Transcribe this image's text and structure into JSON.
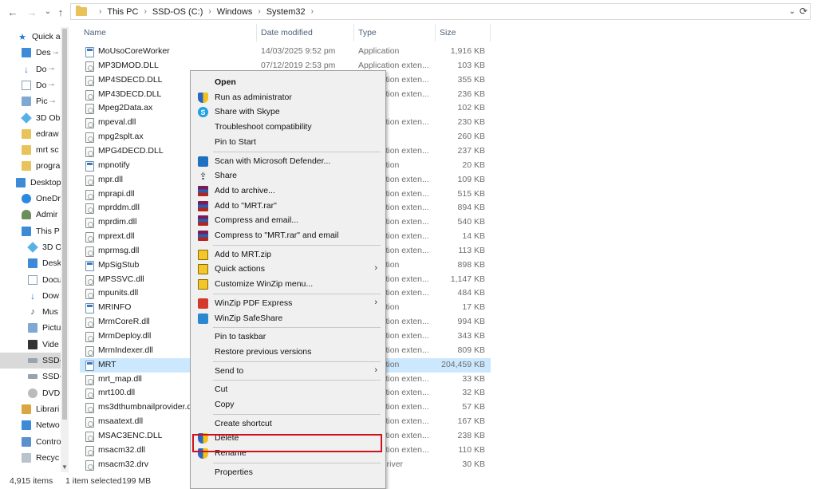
{
  "nav": {
    "back": "←",
    "forward": "→",
    "recent": "⌄",
    "up": "↑",
    "path": [
      "This PC",
      "SSD-OS (C:)",
      "Windows",
      "System32"
    ],
    "sep": "›",
    "dropdown": "⌄",
    "refresh": "⟳"
  },
  "navpane": [
    {
      "label": "Quick a",
      "icon": "star-icon",
      "pin": ""
    },
    {
      "label": "Des",
      "icon": "desktop-icon",
      "pin": "📌"
    },
    {
      "label": "Do",
      "icon": "download-icon",
      "pin": "📌"
    },
    {
      "label": "Do",
      "icon": "documents-icon",
      "pin": "📌"
    },
    {
      "label": "Pic",
      "icon": "pictures-icon",
      "pin": "📌"
    },
    {
      "label": "3D Ob",
      "icon": "3d-objects-icon",
      "pin": ""
    },
    {
      "label": "edraw",
      "icon": "folder-icon",
      "pin": ""
    },
    {
      "label": "mrt sc",
      "icon": "folder-icon",
      "pin": ""
    },
    {
      "label": "progra",
      "icon": "folder-icon",
      "pin": ""
    },
    {
      "label": "Desktop",
      "icon": "desktop-icon",
      "pin": ""
    },
    {
      "label": "OneDr",
      "icon": "onedrive-icon",
      "pin": ""
    },
    {
      "label": "Admir",
      "icon": "user-icon",
      "pin": ""
    },
    {
      "label": "This P",
      "icon": "computer-icon",
      "pin": ""
    },
    {
      "label": "3D O",
      "icon": "3d-objects-icon",
      "pin": ""
    },
    {
      "label": "Desk",
      "icon": "desktop-icon",
      "pin": ""
    },
    {
      "label": "Docu",
      "icon": "documents-icon",
      "pin": ""
    },
    {
      "label": "Dow",
      "icon": "download-icon",
      "pin": ""
    },
    {
      "label": "Mus",
      "icon": "music-icon",
      "pin": ""
    },
    {
      "label": "Pictu",
      "icon": "pictures-icon",
      "pin": ""
    },
    {
      "label": "Vide",
      "icon": "videos-icon",
      "pin": ""
    },
    {
      "label": "SSD-",
      "icon": "drive-icon",
      "pin": ""
    },
    {
      "label": "SSD-",
      "icon": "drive-icon",
      "pin": ""
    },
    {
      "label": "DVD",
      "icon": "dvd-icon",
      "pin": ""
    },
    {
      "label": "Librari",
      "icon": "library-icon",
      "pin": ""
    },
    {
      "label": "Netwo",
      "icon": "network-icon",
      "pin": ""
    },
    {
      "label": "Contro",
      "icon": "control-panel-icon",
      "pin": ""
    },
    {
      "label": "Recyc",
      "icon": "recycle-bin-icon",
      "pin": ""
    }
  ],
  "columns": {
    "name": "Name",
    "date": "Date modified",
    "type": "Type",
    "size": "Size"
  },
  "files": [
    {
      "name": "MoUsoCoreWorker",
      "date": "14/03/2025 9:52 pm",
      "type": "Application",
      "size": "1,916 KB",
      "kind": "app"
    },
    {
      "name": "MP3DMOD.DLL",
      "date": "07/12/2019 2:53 pm",
      "type": "Application exten...",
      "size": "103 KB",
      "kind": "dll"
    },
    {
      "name": "MP4SDECD.DLL",
      "date": "",
      "type": "Application exten...",
      "size": "355 KB",
      "kind": "dll"
    },
    {
      "name": "MP43DECD.DLL",
      "date": "",
      "type": "Application exten...",
      "size": "236 KB",
      "kind": "dll"
    },
    {
      "name": "Mpeg2Data.ax",
      "date": "",
      "type": "",
      "size": "102 KB",
      "kind": "dll"
    },
    {
      "name": "mpeval.dll",
      "date": "",
      "type": "Application exten...",
      "size": "230 KB",
      "kind": "dll"
    },
    {
      "name": "mpg2splt.ax",
      "date": "",
      "type": "",
      "size": "260 KB",
      "kind": "dll"
    },
    {
      "name": "MPG4DECD.DLL",
      "date": "",
      "type": "Application exten...",
      "size": "237 KB",
      "kind": "dll"
    },
    {
      "name": "mpnotify",
      "date": "",
      "type": "Application",
      "size": "20 KB",
      "kind": "app"
    },
    {
      "name": "mpr.dll",
      "date": "",
      "type": "Application exten...",
      "size": "109 KB",
      "kind": "dll"
    },
    {
      "name": "mprapi.dll",
      "date": "",
      "type": "Application exten...",
      "size": "515 KB",
      "kind": "dll"
    },
    {
      "name": "mprddm.dll",
      "date": "",
      "type": "Application exten...",
      "size": "894 KB",
      "kind": "dll"
    },
    {
      "name": "mprdim.dll",
      "date": "",
      "type": "Application exten...",
      "size": "540 KB",
      "kind": "dll"
    },
    {
      "name": "mprext.dll",
      "date": "",
      "type": "Application exten...",
      "size": "14 KB",
      "kind": "dll"
    },
    {
      "name": "mprmsg.dll",
      "date": "",
      "type": "Application exten...",
      "size": "113 KB",
      "kind": "dll"
    },
    {
      "name": "MpSigStub",
      "date": "",
      "type": "Application",
      "size": "898 KB",
      "kind": "app"
    },
    {
      "name": "MPSSVC.dll",
      "date": "",
      "type": "Application exten...",
      "size": "1,147 KB",
      "kind": "dll"
    },
    {
      "name": "mpunits.dll",
      "date": "",
      "type": "Application exten...",
      "size": "484 KB",
      "kind": "dll"
    },
    {
      "name": "MRINFO",
      "date": "",
      "type": "Application",
      "size": "17 KB",
      "kind": "app"
    },
    {
      "name": "MrmCoreR.dll",
      "date": "",
      "type": "Application exten...",
      "size": "994 KB",
      "kind": "dll"
    },
    {
      "name": "MrmDeploy.dll",
      "date": "",
      "type": "Application exten...",
      "size": "343 KB",
      "kind": "dll"
    },
    {
      "name": "MrmIndexer.dll",
      "date": "",
      "type": "Application exten...",
      "size": "809 KB",
      "kind": "dll"
    },
    {
      "name": "MRT",
      "date": "",
      "type": "Application",
      "size": "204,459 KB",
      "kind": "app",
      "selected": true
    },
    {
      "name": "mrt_map.dll",
      "date": "",
      "type": "Application exten...",
      "size": "33 KB",
      "kind": "dll"
    },
    {
      "name": "mrt100.dll",
      "date": "",
      "type": "Application exten...",
      "size": "32 KB",
      "kind": "dll"
    },
    {
      "name": "ms3dthumbnailprovider.dll",
      "date": "",
      "type": "Application exten...",
      "size": "57 KB",
      "kind": "dll"
    },
    {
      "name": "msaatext.dll",
      "date": "",
      "type": "Application exten...",
      "size": "167 KB",
      "kind": "dll"
    },
    {
      "name": "MSAC3ENC.DLL",
      "date": "",
      "type": "Application exten...",
      "size": "238 KB",
      "kind": "dll"
    },
    {
      "name": "msacm32.dll",
      "date": "",
      "type": "Application exten...",
      "size": "110 KB",
      "kind": "dll"
    },
    {
      "name": "msacm32.drv",
      "date": "",
      "type": "Audio driver",
      "size": "30 KB",
      "kind": "dll"
    }
  ],
  "status": {
    "items": "4,915 items",
    "selected": "1 item selected",
    "size": "199 MB"
  },
  "menu": [
    {
      "label": "Open",
      "icon": "",
      "bold": true
    },
    {
      "label": "Run as administrator",
      "icon": "shield-icon"
    },
    {
      "label": "Share with Skype",
      "icon": "skype-icon"
    },
    {
      "label": "Troubleshoot compatibility",
      "icon": ""
    },
    {
      "label": "Pin to Start",
      "icon": ""
    },
    {
      "sep": true
    },
    {
      "label": "Scan with Microsoft Defender...",
      "icon": "defender-icon"
    },
    {
      "label": "Share",
      "icon": "share-icon"
    },
    {
      "label": "Add to archive...",
      "icon": "winrar-icon"
    },
    {
      "label": "Add to \"MRT.rar\"",
      "icon": "winrar-icon"
    },
    {
      "label": "Compress and email...",
      "icon": "winrar-icon"
    },
    {
      "label": "Compress to \"MRT.rar\" and email",
      "icon": "winrar-icon"
    },
    {
      "sep": true
    },
    {
      "label": "Add to MRT.zip",
      "icon": "winzip-icon"
    },
    {
      "label": "Quick actions",
      "icon": "winzip-icon",
      "submenu": true
    },
    {
      "label": "Customize WinZip menu...",
      "icon": "winzip-icon"
    },
    {
      "sep": true
    },
    {
      "label": "WinZip PDF Express",
      "icon": "winzip-pdf-icon",
      "submenu": true
    },
    {
      "label": "WinZip SafeShare",
      "icon": "winzip-safeshare-icon"
    },
    {
      "sep": true
    },
    {
      "label": "Pin to taskbar",
      "icon": ""
    },
    {
      "label": "Restore previous versions",
      "icon": ""
    },
    {
      "sep": true
    },
    {
      "label": "Send to",
      "icon": "",
      "submenu": true
    },
    {
      "sep": true
    },
    {
      "label": "Cut",
      "icon": ""
    },
    {
      "label": "Copy",
      "icon": ""
    },
    {
      "sep": true
    },
    {
      "label": "Create shortcut",
      "icon": ""
    },
    {
      "label": "Delete",
      "icon": "shield-icon",
      "highlighted": true
    },
    {
      "label": "Rename",
      "icon": "shield-icon"
    },
    {
      "sep": true
    },
    {
      "label": "Properties",
      "icon": ""
    }
  ],
  "submenu_arrow": "›",
  "colors": {
    "selection": "#cce8ff",
    "highlight": "#d0111b",
    "header_text": "#4c607a"
  }
}
